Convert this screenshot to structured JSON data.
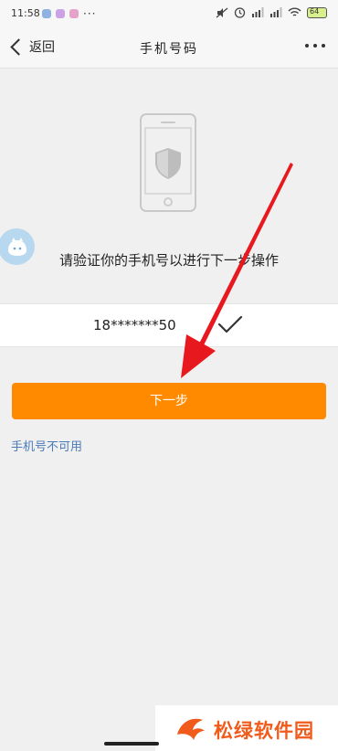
{
  "status_bar": {
    "time": "11:58",
    "more": "···",
    "battery": "64"
  },
  "nav": {
    "back_label": "返回",
    "title": "手机号码"
  },
  "main": {
    "instruction": "请验证你的手机号以进行下一步操作",
    "phone_number": "18*******50",
    "next_button": "下一步",
    "unavailable_link": "手机号不可用"
  },
  "watermark": {
    "text": "松绿软件园"
  },
  "colors": {
    "accent": "#ff8a00",
    "link": "#4a7bb7",
    "annotation": "#e8191e"
  }
}
